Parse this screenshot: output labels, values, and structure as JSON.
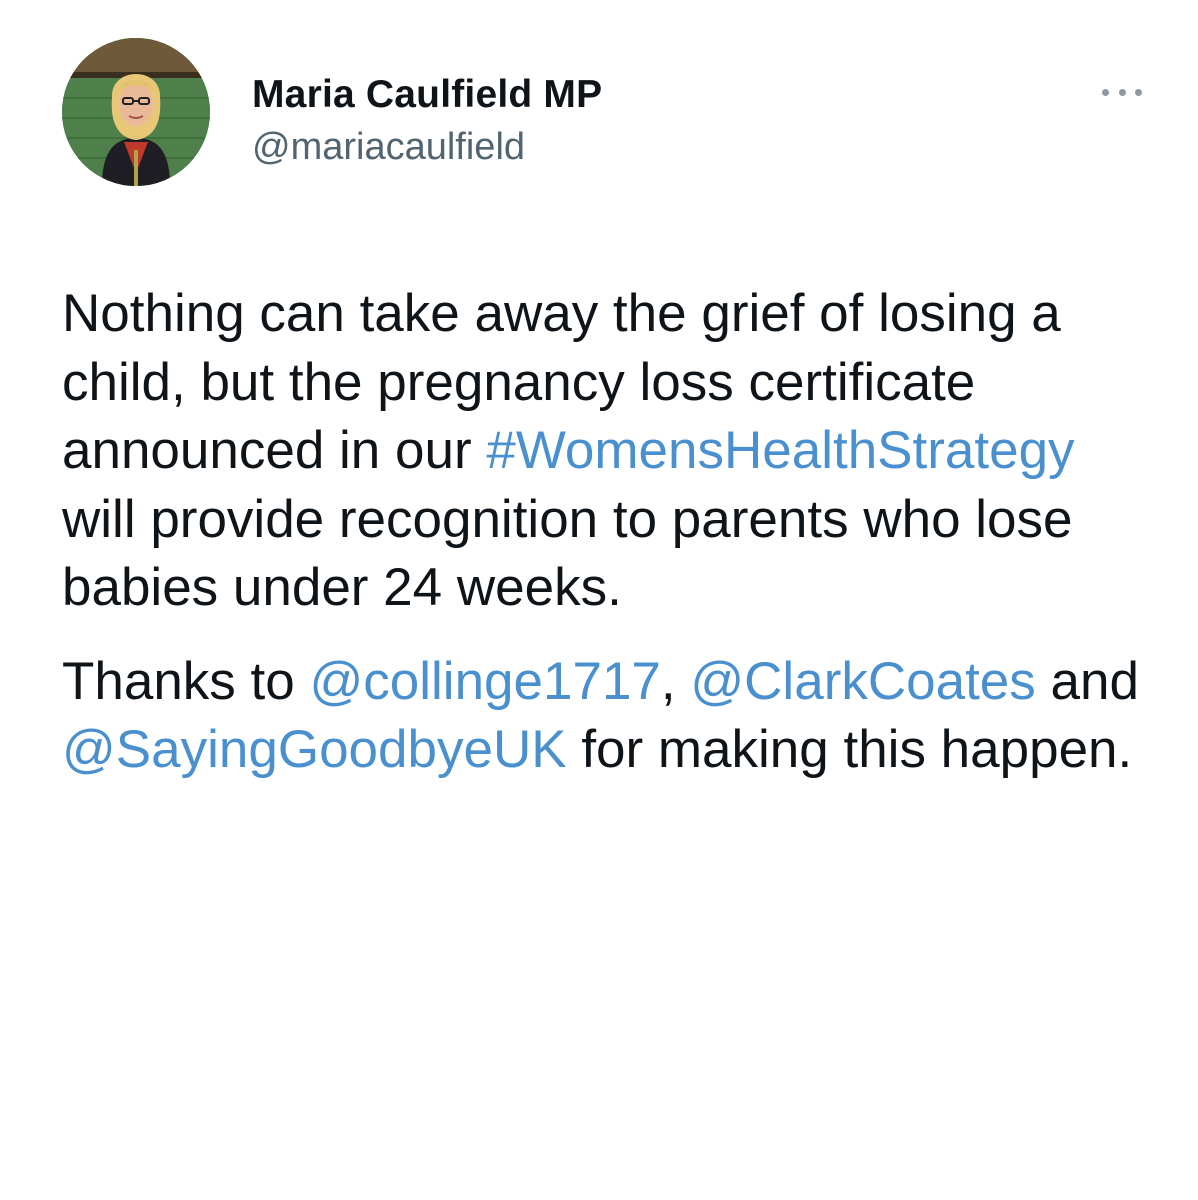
{
  "author": {
    "display_name": "Maria Caulfield MP",
    "handle": "@mariacaulfield"
  },
  "menu": {
    "icon": "more-horizontal-icon"
  },
  "colors": {
    "text": "#0f1419",
    "secondary": "#536471",
    "link": "#4a90cf"
  },
  "tweet": {
    "p1_a": "Nothing can take away the grief of losing a child, but the pregnancy loss certificate announced in our ",
    "hashtag": "#WomensHealthStrategy",
    "p1_b": " will provide recognition to parents who lose babies under 24 weeks.",
    "p2_a": "Thanks to ",
    "mention1": "@collinge1717",
    "p2_b": ", ",
    "mention2": "@ClarkCoates",
    "p2_c": " and ",
    "mention3": "@SayingGoodbyeUK",
    "p2_d": " for making this happen."
  }
}
